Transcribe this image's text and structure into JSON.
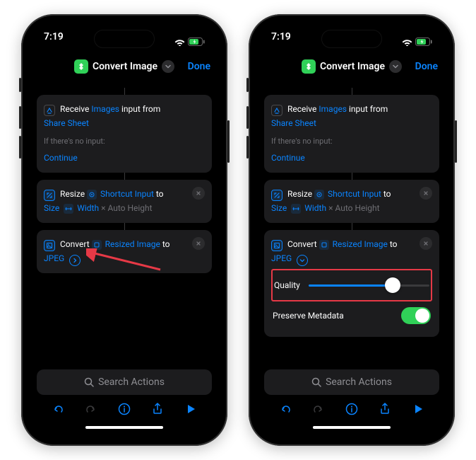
{
  "status": {
    "time": "7:19"
  },
  "nav": {
    "title": "Convert Image",
    "done": "Done"
  },
  "receive_card": {
    "word_receive": "Receive",
    "images": "Images",
    "input_from": "input from",
    "share_sheet": "Share Sheet",
    "no_input_hint": "If there's no input:",
    "continue": "Continue"
  },
  "resize_card": {
    "resize": "Resize",
    "shortcut_input": "Shortcut Input",
    "to": "to",
    "size": "Size",
    "width": "Width",
    "times": "×",
    "auto_height": "Auto Height"
  },
  "convert_card": {
    "convert": "Convert",
    "resized_image": "Resized Image",
    "to": "to",
    "jpeg": "JPEG"
  },
  "expanded": {
    "quality": "Quality",
    "preserve_meta": "Preserve Metadata"
  },
  "search": {
    "placeholder": "Search Actions"
  }
}
